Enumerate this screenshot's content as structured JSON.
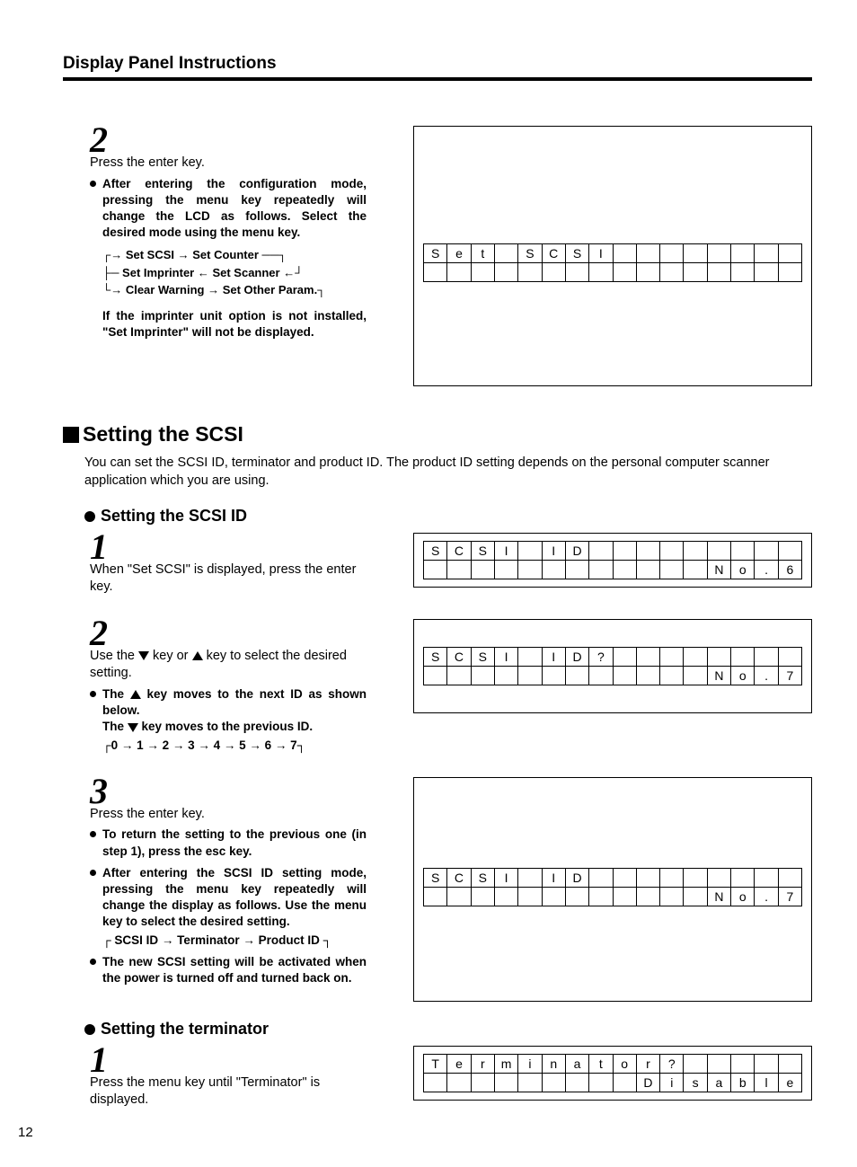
{
  "header": "Display Panel Instructions",
  "pagenum": "12",
  "topstep": {
    "num": "2",
    "title": "Press the enter key.",
    "bullet": "After entering the configuration mode, pressing the menu key repeatedly will change the LCD as follows. Select the desired mode using the menu key.",
    "seq1": "Set SCSI → Set Counter",
    "seq2": "Set Imprinter ← Set Scanner ←",
    "seq3": "Clear Warning → Set Other Param.",
    "note": "If the imprinter unit option is not installed, \"Set Imprinter\" will not be displayed.",
    "lcd": {
      "row1": [
        "S",
        "e",
        "t",
        "",
        "S",
        "C",
        "S",
        "I",
        "",
        "",
        "",
        "",
        "",
        "",
        "",
        ""
      ],
      "row2": [
        "",
        "",
        "",
        "",
        "",
        "",
        "",
        "",
        "",
        "",
        "",
        "",
        "",
        "",
        "",
        ""
      ]
    }
  },
  "sec": {
    "title": "Setting the SCSI",
    "intro": "You can set the SCSI ID, terminator and product ID. The product ID setting depends on the personal computer scanner application which you are using."
  },
  "sub1": {
    "title": "Setting the SCSI ID",
    "s1": {
      "num": "1",
      "text": "When \"Set SCSI\" is displayed, press the enter key.",
      "lcd": {
        "row1": [
          "S",
          "C",
          "S",
          "I",
          "",
          "I",
          "D",
          "",
          "",
          "",
          "",
          "",
          "",
          "",
          "",
          ""
        ],
        "row2": [
          "",
          "",
          "",
          "",
          "",
          "",
          "",
          "",
          "",
          "",
          "",
          "",
          "N",
          "o",
          ".",
          "6"
        ]
      }
    },
    "s2": {
      "num": "2",
      "text_a": "Use the ",
      "text_b": " key or ",
      "text_c": " key to select the desired setting.",
      "b1_a": "The ",
      "b1_b": " key moves to the next ID as shown below.",
      "b2_a": "The ",
      "b2_b": " key moves to the previous ID.",
      "seq": "0 → 1 → 2 → 3 → 4 → 5 → 6 → 7",
      "lcd": {
        "row1": [
          "S",
          "C",
          "S",
          "I",
          "",
          "I",
          "D",
          "?",
          "",
          "",
          "",
          "",
          "",
          "",
          "",
          ""
        ],
        "row2": [
          "",
          "",
          "",
          "",
          "",
          "",
          "",
          "",
          "",
          "",
          "",
          "",
          "N",
          "o",
          ".",
          "7"
        ]
      }
    },
    "s3": {
      "num": "3",
      "text": "Press the enter key.",
      "b1": "To return the setting to the previous one (in step 1), press the esc key.",
      "b2": "After entering the SCSI ID setting mode, pressing the menu key repeatedly will change the display as follows. Use the menu key to select the desired setting.",
      "seq": "SCSI ID → Terminator → Product ID",
      "b3": "The new SCSI setting will be activated when the power is turned off and turned back on.",
      "lcd": {
        "row1": [
          "S",
          "C",
          "S",
          "I",
          "",
          "I",
          "D",
          "",
          "",
          "",
          "",
          "",
          "",
          "",
          "",
          ""
        ],
        "row2": [
          "",
          "",
          "",
          "",
          "",
          "",
          "",
          "",
          "",
          "",
          "",
          "",
          "N",
          "o",
          ".",
          "7"
        ]
      }
    }
  },
  "sub2": {
    "title": "Setting the terminator",
    "s1": {
      "num": "1",
      "text": "Press the menu key until \"Terminator\" is displayed.",
      "lcd": {
        "row1": [
          "T",
          "e",
          "r",
          "m",
          "i",
          "n",
          "a",
          "t",
          "o",
          "r",
          "?",
          "",
          "",
          "",
          "",
          ""
        ],
        "row2": [
          "",
          "",
          "",
          "",
          "",
          "",
          "",
          "",
          "",
          "D",
          "i",
          "s",
          "a",
          "b",
          "l",
          "e"
        ]
      }
    }
  }
}
